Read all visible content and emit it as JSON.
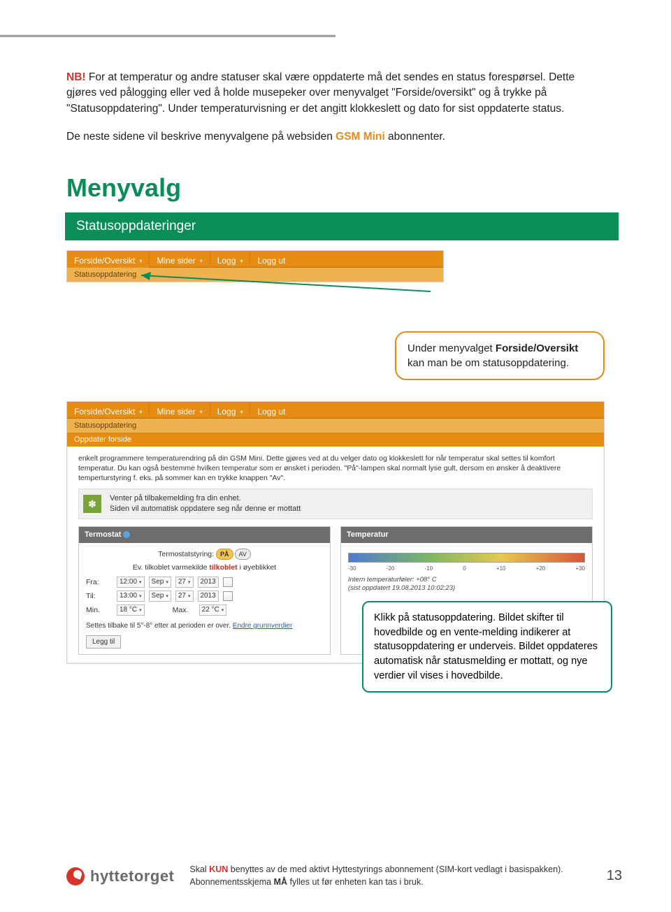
{
  "intro": {
    "nb": "NB!",
    "p1_a": " For at temperatur og andre statuser skal være oppdaterte må det sendes en status forespørsel. Dette gjøres ved pålogging eller ved å holde musepeker over menyvalget \"Forside/oversikt\" og å trykke på \"Statusoppdatering\". Under temperaturvisning er det angitt klokkeslett og dato for sist oppdaterte status.",
    "p2_a": "De neste sidene vil beskrive menyvalgene på websiden ",
    "gsm": "GSM Mini",
    "p2_b": " abonnenter."
  },
  "h1": "Menyvalg",
  "banner": "Statusoppdateringer",
  "nav": {
    "items": [
      "Forside/Oversikt",
      "Mine sider",
      "Logg",
      "Logg ut"
    ],
    "sub": "Statusoppdatering",
    "oppdater": "Oppdater forside"
  },
  "callout1": {
    "a": "Under menyvalget ",
    "b": "Forside/Oversikt",
    "c": " kan man be om statusoppdatering."
  },
  "bigshot": {
    "descr": "enkelt programmere temperaturendring på din GSM Mini. Dette gjøres ved at du velger dato og klokkeslett for når temperatur skal settes til komfort temperatur. Du kan også bestemme hvilken temperatur som er ønsket i perioden. \"På\"-lampen skal normalt lyse gult, dersom en ønsker å deaktivere temperturstyring f. eks. på sommer kan en trykke knappen \"Av\".",
    "wait_l1": "Venter på tilbakemelding fra din enhet.",
    "wait_l2": "Siden vil automatisk oppdatere seg når denne er mottatt"
  },
  "thermo": {
    "head": "Termostat",
    "styring_lbl": "Termostatstyring:",
    "pa": "PÅ",
    "av": "AV",
    "varmekilde_a": "Ev. tilkoblet varmekilde ",
    "varmekilde_b": "tilkoblet",
    "varmekilde_c": " i øyeblikket",
    "rows": {
      "fra": "Fra:",
      "til": "Til:",
      "min": "Min.",
      "max": "Max."
    },
    "sel": {
      "t1": "12:00",
      "t2": "13:00",
      "m": "Sep",
      "d": "27",
      "y": "2013",
      "min": "18 °C",
      "max": "22 °C"
    },
    "note_a": "Settes tilbake til 5°-8° etter at perioden er over. ",
    "note_link": "Endre grunnverdier",
    "btn": "Legg til"
  },
  "temp_panel": {
    "head": "Temperatur",
    "ticks": [
      "-30",
      "-20",
      "-10",
      "0",
      "+10",
      "+20",
      "+30"
    ],
    "info_a": "Intern temperaturføler: +08° C",
    "info_b": "(sist oppdatert 19.08.2013 10:02:23)"
  },
  "callout2": "Klikk på statusoppdatering. Bildet skifter til hovedbilde og en vente-melding indikerer at statusoppdatering er underveis. Bildet oppdateres automatisk når statusmelding er mottatt, og nye verdier vil vises i hovedbilde.",
  "footer": {
    "brand": "hyttetorget",
    "note_a": "Skal ",
    "kun": "KUN",
    "note_b": " benyttes av de med aktivt Hyttestyrings abonnement (SIM-kort vedlagt i basispakken). Abonnementsskjema ",
    "maa": "MÅ",
    "note_c": " fylles ut før enheten kan tas i bruk.",
    "page": "13"
  }
}
